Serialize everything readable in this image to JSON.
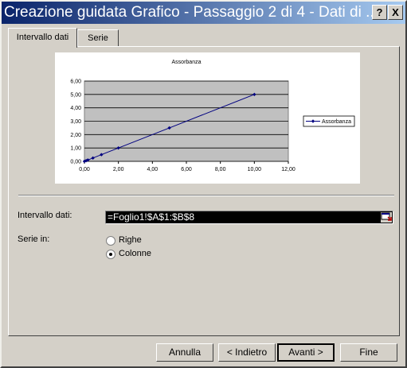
{
  "window": {
    "title": "Creazione guidata Grafico - Passaggio 2 di 4 - Dati di ...",
    "help_button": "?",
    "close_button": "X"
  },
  "tabs": [
    {
      "label": "Intervallo dati",
      "active": true
    },
    {
      "label": "Serie",
      "active": false
    }
  ],
  "chart_data": {
    "type": "line",
    "title": "Assorbanza",
    "x": [
      0,
      0.1,
      0.2,
      0.5,
      1,
      2,
      5,
      10
    ],
    "series": [
      {
        "name": "Assorbanza",
        "values": [
          0,
          0.05,
          0.1,
          0.25,
          0.5,
          1,
          2.5,
          5
        ],
        "color": "#000080"
      }
    ],
    "xlim": [
      0,
      12
    ],
    "ylim": [
      0,
      6
    ],
    "xticks": [
      "0,00",
      "2,00",
      "4,00",
      "6,00",
      "8,00",
      "10,00",
      "12,00"
    ],
    "yticks": [
      "0,00",
      "0,50",
      "1,00",
      "1,50",
      "2,00",
      "2,50",
      "3,00",
      "3,50",
      "4,00",
      "4,50",
      "5,00",
      "5,50",
      "6,00"
    ],
    "ytick_labels": [
      "0,00",
      "1,00",
      "2,00",
      "3,00",
      "4,00",
      "5,00",
      "6,00"
    ],
    "plot_background": "#c0c0c0",
    "grid": true,
    "legend": "right",
    "xlabel": "",
    "ylabel": ""
  },
  "data_range": {
    "label": "Intervallo dati:",
    "value": "=Foglio1!$A$1:$B$8"
  },
  "series_in": {
    "label": "Serie in:",
    "options": [
      {
        "label": "Righe",
        "selected": false
      },
      {
        "label": "Colonne",
        "selected": true
      }
    ]
  },
  "buttons": {
    "cancel": "Annulla",
    "back": "< Indietro",
    "next": "Avanti >",
    "finish": "Fine"
  }
}
